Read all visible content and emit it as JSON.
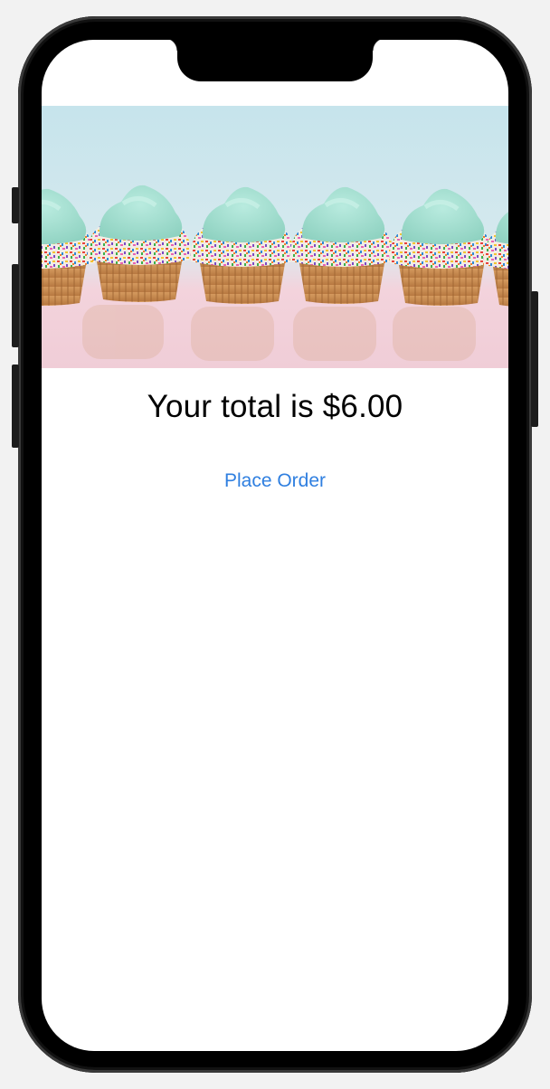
{
  "order": {
    "total_label": "Your total is $6.00",
    "place_order_label": "Place Order"
  },
  "hero": {
    "image_name": "cupcakes-image"
  },
  "colors": {
    "accent": "#2f7fe0",
    "frosting": "#a5dfd0",
    "background_top": "#cfe7ee",
    "table": "#f1d6de"
  }
}
